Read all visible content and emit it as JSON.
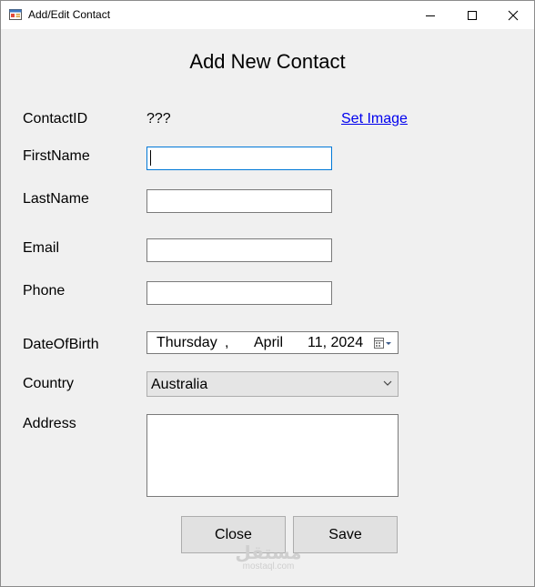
{
  "window": {
    "title": "Add/Edit Contact",
    "controls": [
      "minimize-icon",
      "maximize-icon",
      "close-icon"
    ]
  },
  "form": {
    "heading": "Add New Contact",
    "contact_id_label": "ContactID",
    "contact_id_value": "???",
    "set_image_link": "Set Image",
    "first_name_label": "FirstName",
    "first_name_value": "",
    "last_name_label": "LastName",
    "last_name_value": "",
    "email_label": "Email",
    "email_value": "",
    "phone_label": "Phone",
    "phone_value": "",
    "dob_label": "DateOfBirth",
    "dob": {
      "weekday": "Thursday",
      "comma1": ",",
      "month": "April",
      "day_year": "11, 2024"
    },
    "country_label": "Country",
    "country_value": "Australia",
    "address_label": "Address",
    "address_value": ""
  },
  "buttons": {
    "close": "Close",
    "save": "Save"
  },
  "watermark": {
    "logo": "مستقل",
    "text": "mostaql.com"
  },
  "colors": {
    "link": "#0000ee",
    "focus_border": "#0078d7",
    "background": "#f0f0f0"
  }
}
